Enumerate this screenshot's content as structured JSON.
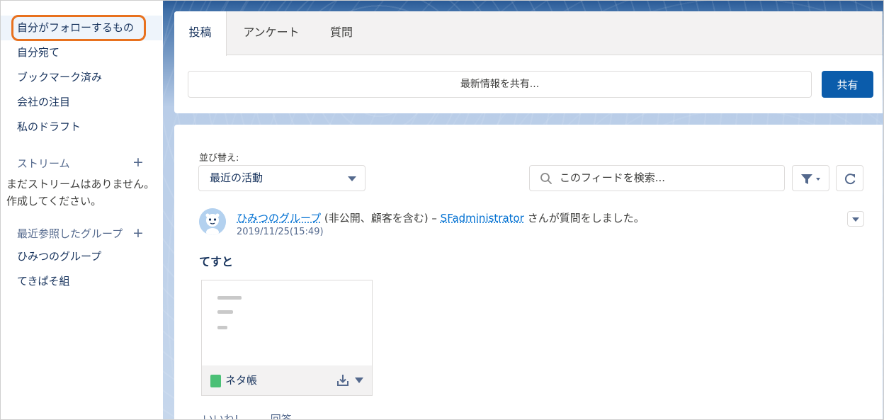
{
  "sidebar": {
    "items": [
      {
        "label": "自分がフォローするもの"
      },
      {
        "label": "自分宛て"
      },
      {
        "label": "ブックマーク済み"
      },
      {
        "label": "会社の注目"
      },
      {
        "label": "私のドラフト"
      }
    ],
    "streams": {
      "title": "ストリーム",
      "add_icon": "plus-icon",
      "empty_text": "まだストリームはありません。 作成してください。"
    },
    "recent_groups": {
      "title": "最近参照したグループ",
      "add_icon": "plus-icon",
      "items": [
        {
          "label": "ひみつのグループ"
        },
        {
          "label": "てきぱそ組"
        }
      ]
    }
  },
  "publisher": {
    "tabs": [
      {
        "label": "投稿"
      },
      {
        "label": "アンケート"
      },
      {
        "label": "質問"
      }
    ],
    "placeholder": "最新情報を共有...",
    "share_label": "共有"
  },
  "feed": {
    "sort_label": "並び替え:",
    "sort_value": "最近の活動",
    "search_placeholder": "このフィードを検索...",
    "post": {
      "group": "ひみつのグループ",
      "group_note": "(非公開、顧客を含む)",
      "separator": "–",
      "author": "SFadministrator",
      "action": "さんが質問をしました。",
      "timestamp": "2019/11/25(15:49)",
      "body": "てすと",
      "file": {
        "name": "ネタ帳",
        "icon": "spreadsheet-icon"
      },
      "actions": {
        "like": "いいね!",
        "answer": "回答"
      }
    }
  },
  "colors": {
    "accent": "#0b5cab",
    "link": "#0070d2",
    "highlight": "#e8711e",
    "selected_bg": "#eef4fb"
  }
}
